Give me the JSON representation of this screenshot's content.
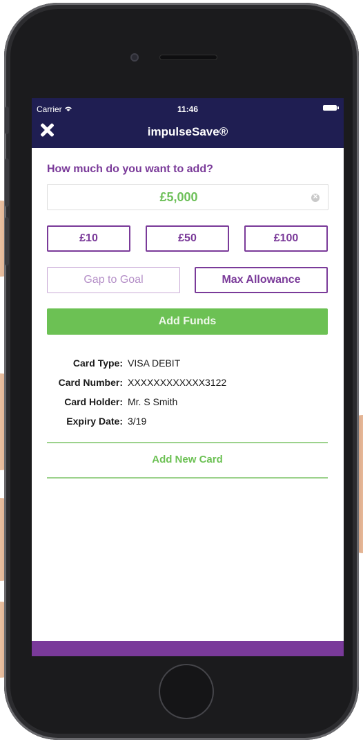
{
  "status_bar": {
    "carrier": "Carrier",
    "time": "11:46"
  },
  "navbar": {
    "title": "impulseSave®"
  },
  "add_funds_form": {
    "question": "How much do you want to add?",
    "amount_value": "£5,000",
    "quick_amounts": [
      "£10",
      "£50",
      "£100"
    ],
    "gap_to_goal_label": "Gap to Goal",
    "max_allowance_label": "Max Allowance",
    "submit_label": "Add Funds"
  },
  "card_details": [
    {
      "label": "Card Type:",
      "value": "VISA DEBIT"
    },
    {
      "label": "Card Number:",
      "value": "XXXXXXXXXXXX3122"
    },
    {
      "label": "Card Holder:",
      "value": "Mr. S Smith"
    },
    {
      "label": "Expiry Date:",
      "value": "3/19"
    }
  ],
  "add_new_card_label": "Add New Card",
  "colors": {
    "navbar": "#1f1e52",
    "accent_purple": "#7a3a99",
    "accent_green": "#6cc154"
  },
  "icons": [
    "close-icon",
    "wifi-icon",
    "battery-icon",
    "clear-icon"
  ]
}
